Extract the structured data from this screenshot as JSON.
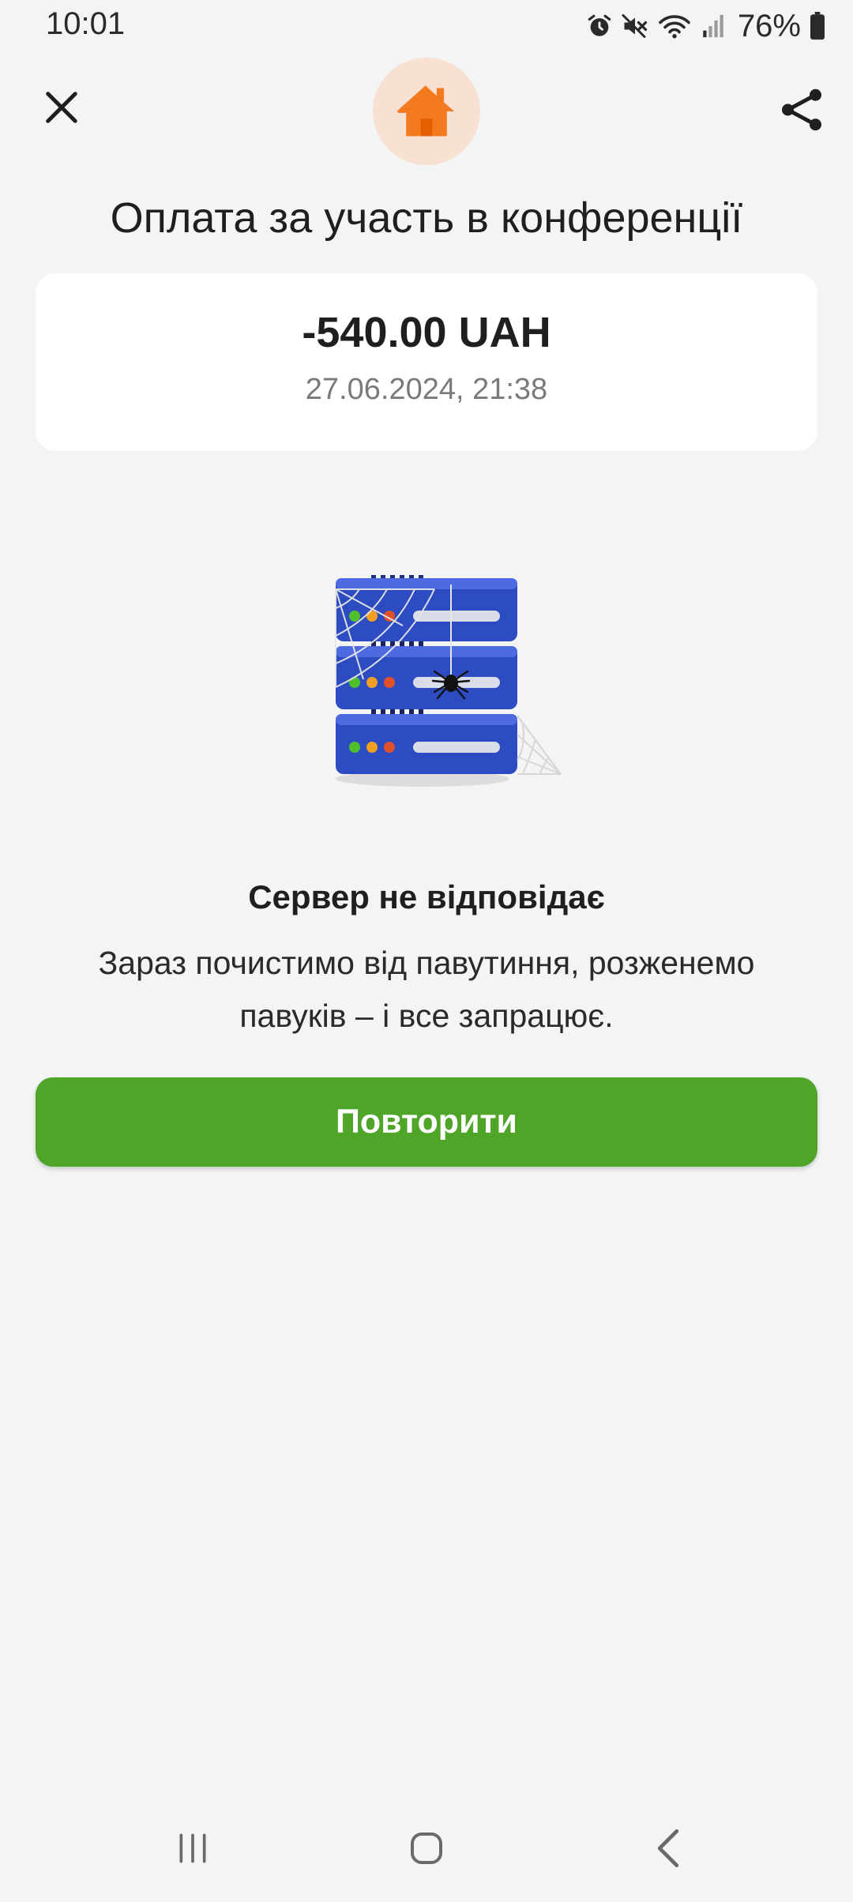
{
  "status_bar": {
    "time": "10:01",
    "battery": "76%",
    "icons": [
      "alarm-icon",
      "mute-icon",
      "wifi-icon",
      "signal-icon",
      "battery-icon"
    ]
  },
  "header": {
    "close_icon": "close-icon",
    "home_icon": "home-icon",
    "share_icon": "share-icon",
    "title": "Оплата за участь в конференції"
  },
  "transaction": {
    "amount": "-540.00 UAH",
    "datetime": "27.06.2024, 21:38"
  },
  "error": {
    "illustration": "server-with-cobwebs-illustration",
    "title": "Сервер не відповідає",
    "message": "Зараз почистимо від павутиння, розженемо павуків – і все запрацює."
  },
  "actions": {
    "retry_label": "Повторити"
  },
  "nav_bar": {
    "icons": [
      "recent-apps-icon",
      "home-nav-icon",
      "back-icon"
    ]
  },
  "colors": {
    "background": "#f3f4f4",
    "accent_orange": "#f47a20",
    "home_badge_bg": "#f8e0d2",
    "button_green": "#4fa528",
    "server_blue": "#2f4ec4"
  }
}
